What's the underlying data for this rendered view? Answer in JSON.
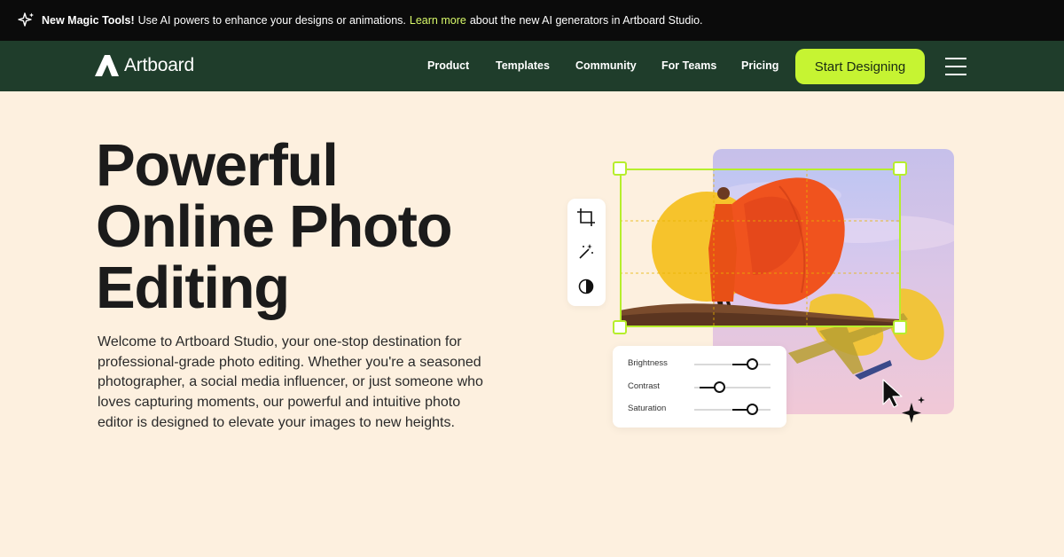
{
  "announcement": {
    "bold": "New Magic Tools!",
    "text": "Use AI powers to enhance your designs or animations.",
    "link": "Learn more",
    "suffix": "about the new AI generators in Artboard Studio."
  },
  "nav": {
    "brand": "Artboard",
    "links": [
      "Product",
      "Templates",
      "Community",
      "For Teams",
      "Pricing"
    ],
    "cta": "Start Designing"
  },
  "hero": {
    "title_lines": [
      "Powerful",
      "Online Photo",
      "Editing"
    ],
    "body": "Welcome to Artboard Studio, your one-stop destination for professional-grade photo editing. Whether you're a seasoned photographer, a social media influencer, or just someone who loves capturing moments, our powerful and intuitive photo editor is designed to elevate your images to new heights."
  },
  "editor": {
    "tools": [
      "crop-icon",
      "magic-wand-icon",
      "contrast-icon"
    ],
    "sliders": [
      {
        "label": "Brightness",
        "value": 0.75
      },
      {
        "label": "Contrast",
        "value": 0.32
      },
      {
        "label": "Saturation",
        "value": 0.75
      }
    ]
  },
  "colors": {
    "background": "#fdf0df",
    "announcement_bg": "#0b0b0b",
    "nav_bg": "#1f3d2b",
    "accent": "#c6f432",
    "link": "#d8f96a"
  }
}
